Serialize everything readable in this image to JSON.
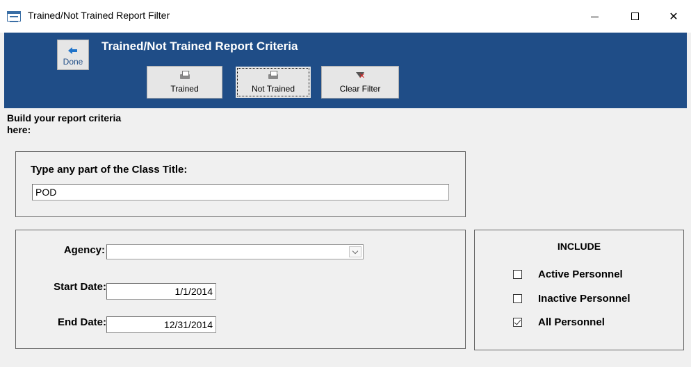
{
  "window": {
    "title": "Trained/Not Trained Report Filter",
    "controls": [
      "minimize",
      "maximize",
      "close"
    ]
  },
  "header": {
    "title": "Trained/Not Trained Report Criteria",
    "done_label": "Done",
    "buttons": [
      {
        "label": "Trained",
        "icon": "printer-icon"
      },
      {
        "label": "Not Trained",
        "icon": "printer-icon"
      },
      {
        "label": "Clear Filter",
        "icon": "filter-clear-icon"
      }
    ]
  },
  "form": {
    "intro": "Build your report criteria here:",
    "class_title": {
      "label": "Type any part of the Class Title:",
      "value": "POD"
    },
    "agency": {
      "label": "Agency:",
      "value": ""
    },
    "start_date": {
      "label": "Start Date:",
      "value": "1/1/2014"
    },
    "end_date": {
      "label": "End Date:",
      "value": "12/31/2014"
    }
  },
  "include": {
    "title": "INCLUDE",
    "options": [
      {
        "label": "Active Personnel",
        "checked": false
      },
      {
        "label": "Inactive Personnel",
        "checked": false
      },
      {
        "label": "All Personnel",
        "checked": true
      }
    ]
  },
  "colors": {
    "header_bg": "#1f4d87",
    "form_bg": "#f0f0f0"
  }
}
